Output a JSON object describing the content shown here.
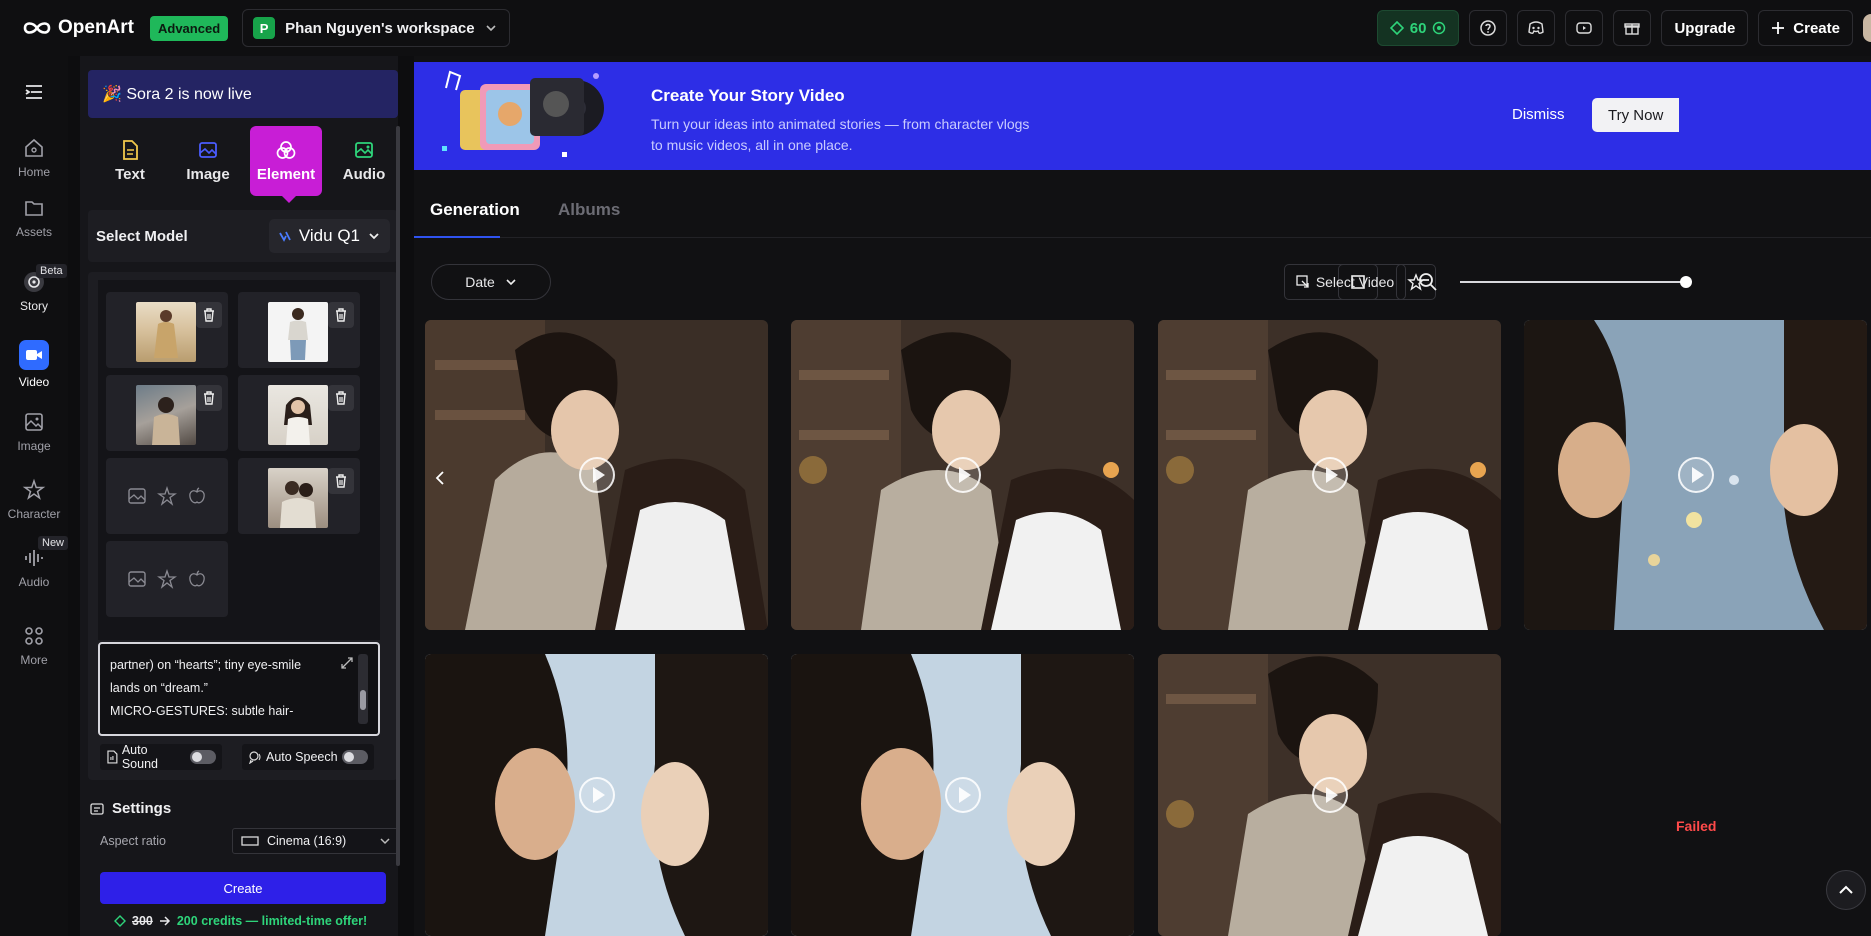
{
  "topbar": {
    "brand": "OpenArt",
    "plan_badge": "Advanced",
    "workspace_initial": "P",
    "workspace_name": "Phan Nguyen's workspace",
    "credits": "60",
    "upgrade_label": "Upgrade",
    "create_label": "Create"
  },
  "leftnav": {
    "items": [
      {
        "label": "Home",
        "icon": "home-icon"
      },
      {
        "label": "Assets",
        "icon": "folder-icon"
      },
      {
        "label": "Story",
        "icon": "story-icon",
        "tag": "Beta"
      },
      {
        "label": "Video",
        "icon": "video-icon",
        "active": true
      },
      {
        "label": "Image",
        "icon": "image-icon"
      },
      {
        "label": "Character",
        "icon": "character-icon"
      },
      {
        "label": "Audio",
        "icon": "audio-icon",
        "tag": "New"
      },
      {
        "label": "More",
        "icon": "grid-icon"
      }
    ]
  },
  "panel": {
    "announcement": "🎉 Sora 2 is now live",
    "type_tabs": [
      {
        "label": "Text",
        "color": "#f2c94c"
      },
      {
        "label": "Image",
        "color": "#4a5cff"
      },
      {
        "label": "Element",
        "color": "#ffffff",
        "active": true
      },
      {
        "label": "Audio",
        "color": "#2ed47a"
      }
    ],
    "model_label": "Select Model",
    "model_value": "Vidu Q1",
    "prompt_lines": [
      "partner) on “hearts”; tiny eye-smile",
      "lands on “dream.”",
      "MICRO-GESTURES: subtle hair-"
    ],
    "auto_sound_label": "Auto Sound",
    "auto_sound_on": false,
    "auto_speech_label": "Auto Speech",
    "auto_speech_on": false,
    "settings_title": "Settings",
    "aspect_label": "Aspect ratio",
    "aspect_value": "Cinema (16:9)",
    "create_label": "Create",
    "offer_old_price": "300",
    "offer_text": "200 credits — limited-time offer!"
  },
  "hero": {
    "title": "Create Your Story Video",
    "subtitle": "Turn your ideas into animated stories — from character vlogs to music videos, all in one place.",
    "dismiss_label": "Dismiss",
    "try_label": "Try Now"
  },
  "main": {
    "tabs": [
      {
        "label": "Generation",
        "active": true
      },
      {
        "label": "Albums",
        "active": false
      }
    ],
    "date_filter": "Date",
    "select_video_label": "Select Video",
    "failed_label": "Failed"
  },
  "colors": {
    "accent": "#2f53f0",
    "element_tab": "#c81ed6",
    "credits_green": "#2ed47a",
    "failed_red": "#ff4a4a"
  }
}
